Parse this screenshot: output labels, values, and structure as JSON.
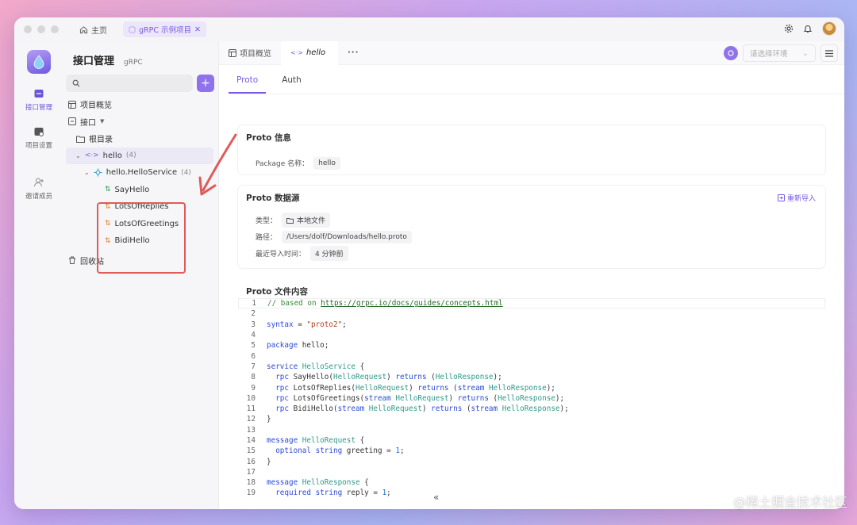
{
  "titlebar": {
    "home_label": "主页",
    "tab_label": "gRPC 示例项目",
    "tab_close": "✕"
  },
  "rail": {
    "items": [
      {
        "label": "接口管理",
        "icon": "api-icon"
      },
      {
        "label": "项目设置",
        "icon": "settings-icon"
      },
      {
        "label": "邀请成员",
        "icon": "add-user-icon"
      }
    ]
  },
  "sidebar": {
    "title": "接口管理",
    "subtitle": "gRPC",
    "add_label": "+",
    "overview": "项目概览",
    "api_label": "接口",
    "root_dir": "根目录",
    "package_node": {
      "name": "hello",
      "count": "(4)"
    },
    "service_node": {
      "name": "hello.HelloService",
      "count": "(4)"
    },
    "methods": [
      {
        "name": "SayHello",
        "icon": "unary-icon"
      },
      {
        "name": "LotsOfReplies",
        "icon": "server-stream-icon"
      },
      {
        "name": "LotsOfGreetings",
        "icon": "client-stream-icon"
      },
      {
        "name": "BidiHello",
        "icon": "bidi-stream-icon"
      }
    ],
    "recycle": "回收站"
  },
  "main": {
    "tabs": [
      {
        "label": "项目概览"
      },
      {
        "label": "hello"
      }
    ],
    "more": "···",
    "env_placeholder": "请选择环境",
    "subtabs": [
      "Proto",
      "Auth"
    ],
    "proto_info": {
      "title": "Proto 信息",
      "package_label": "Package 名称：",
      "package_value": "hello"
    },
    "proto_source": {
      "title": "Proto 数据源",
      "reimport": "重新导入",
      "type_label": "类型：",
      "type_value": "本地文件",
      "path_label": "路径：",
      "path_value": "/Users/dolf/Downloads/hello.proto",
      "time_label": "最近导入时间：",
      "time_value": "4 分钟前"
    },
    "proto_content": {
      "title": "Proto 文件内容"
    },
    "collapse": "«"
  },
  "code_lines": [
    "// based on https://grpc.io/docs/guides/concepts.html",
    "",
    "syntax = \"proto2\";",
    "",
    "package hello;",
    "",
    "service HelloService {",
    "  rpc SayHello(HelloRequest) returns (HelloResponse);",
    "  rpc LotsOfReplies(HelloRequest) returns (stream HelloResponse);",
    "  rpc LotsOfGreetings(stream HelloRequest) returns (HelloResponse);",
    "  rpc BidiHello(stream HelloRequest) returns (stream HelloResponse);",
    "}",
    "",
    "message HelloRequest {",
    "  optional string greeting = 1;",
    "}",
    "",
    "message HelloResponse {",
    "  required string reply = 1;"
  ],
  "watermark": "@稀土掘金技术社区",
  "colors": {
    "accent": "#7a5ae0",
    "highlight_box": "#e05a5a"
  }
}
